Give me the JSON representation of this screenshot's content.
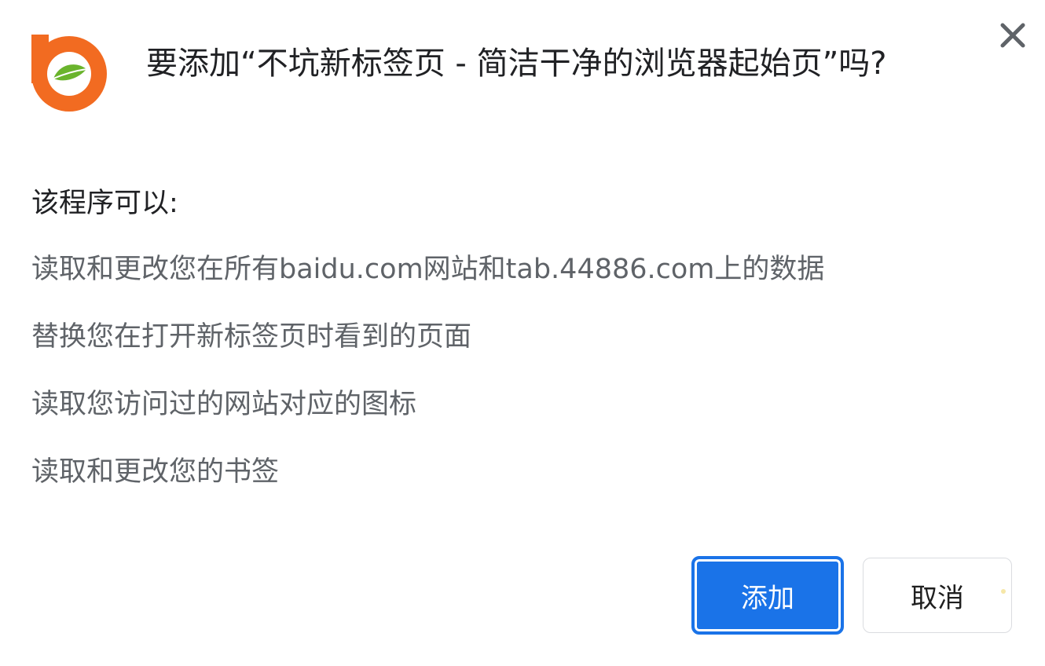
{
  "dialog": {
    "title": "要添加“不坑新标签页 - 简洁干净的浏览器起始页”吗?",
    "logo_icon": "bing-style-leaf-logo-icon",
    "close_icon": "close-icon",
    "permissions_heading": "该程序可以:",
    "permissions": [
      "读取和更改您在所有baidu.com网站和tab.44886.com上的数据",
      "替换您在打开新标签页时看到的页面",
      "读取您访问过的网站对应的图标",
      "读取和更改您的书签"
    ],
    "add_label": "添加",
    "cancel_label": "取消"
  },
  "colors": {
    "logo_orange": "#f26b21",
    "logo_leaf": "#6ab42d",
    "primary_blue": "#1a73e8",
    "title_text": "#202124",
    "body_text": "#5f6368"
  }
}
